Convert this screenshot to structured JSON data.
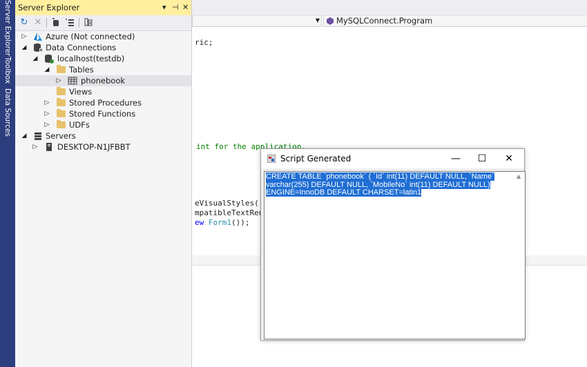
{
  "left_strip": {
    "tabs": [
      "Server Explorer",
      "Toolbox",
      "Data Sources"
    ]
  },
  "server_explorer": {
    "title": "Server Explorer",
    "title_icons": [
      "chevron-down-icon",
      "pin-icon",
      "close-icon"
    ],
    "toolbar_icons": [
      "refresh-icon",
      "stop-icon",
      "connect-to-database-icon",
      "connect-to-server-icon",
      "sharepoint-connection-icon"
    ],
    "tree": [
      {
        "label": "Azure (Not connected)",
        "icon": "azure-icon",
        "expanded": false,
        "level": 0
      },
      {
        "label": "Data Connections",
        "icon": "data-connections-icon",
        "expanded": true,
        "level": 0
      },
      {
        "label": "localhost(testdb)",
        "icon": "database-connection-icon",
        "expanded": true,
        "level": 1
      },
      {
        "label": "Tables",
        "icon": "folder-icon",
        "expanded": true,
        "level": 2
      },
      {
        "label": "phonebook",
        "icon": "table-icon",
        "expanded": false,
        "level": 3,
        "selected": true
      },
      {
        "label": "Views",
        "icon": "folder-icon",
        "expanded": null,
        "level": 2
      },
      {
        "label": "Stored Procedures",
        "icon": "folder-icon",
        "expanded": false,
        "level": 2
      },
      {
        "label": "Stored Functions",
        "icon": "folder-icon",
        "expanded": false,
        "level": 2
      },
      {
        "label": "UDFs",
        "icon": "folder-icon",
        "expanded": false,
        "level": 2
      },
      {
        "label": "Servers",
        "icon": "servers-icon",
        "expanded": true,
        "level": 0
      },
      {
        "label": "DESKTOP-N1JFBBT",
        "icon": "computer-icon",
        "expanded": false,
        "level": 1
      }
    ]
  },
  "editor": {
    "navigation_member": "MySQLConnect.Program",
    "code_fragments": {
      "line1": "ric;",
      "line2": "int for the application.",
      "line3": "eVisualStyles()",
      "line4": "mpatibleTextRen",
      "line5_kw": "ew ",
      "line5_type": "Form1",
      "line5_rest": "());"
    }
  },
  "dialog": {
    "title": "Script Generated",
    "buttons": [
      "minimize",
      "maximize",
      "close"
    ],
    "script": "CREATE TABLE `phonebook` (  `Id` int(11) DEFAULT NULL,  `Name` varchar(255) DEFAULT NULL,  `MobileNo` int(11) DEFAULT NULL) ENGINE=InnoDB DEFAULT CHARSET=latin1"
  },
  "colors": {
    "strip": "#2d3e7e",
    "title_highlight": "#ffef9e",
    "selection": "#1f6ed4",
    "code_comment": "#008000",
    "code_type": "#2b91af",
    "code_keyword": "#0000ff"
  }
}
